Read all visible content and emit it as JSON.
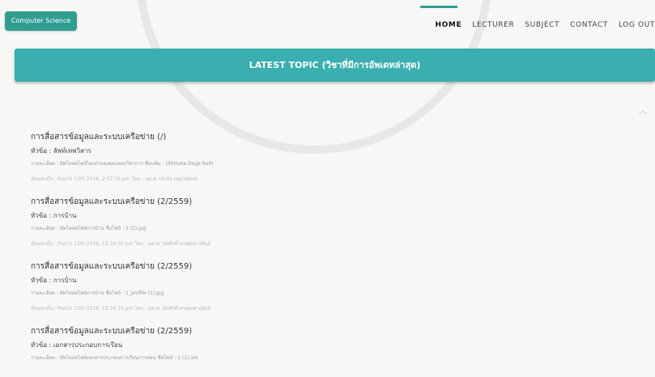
{
  "brand": "Computer Science",
  "nav": {
    "home": "HOME",
    "lecturer": "LECTURER",
    "subject": "SUBJECT",
    "contact": "CONTACT",
    "logout": "LOG OUT"
  },
  "banner": "LATEST TOPIC (วิชาที่มีการอัพเดทล่าสุด)",
  "posts": [
    {
      "title": "การสื่อสารข้อมูลและระบบเครือข่าย (/)",
      "subject": "หัวข้อ : ลัพท์เทพวิสาร",
      "detail": "รายละเอียด : อัพโหลดไฟล์ไอเท่าของคุณเพลงวิชาการ ชื่อแฟ้ม : Ultimate Doge Bath",
      "meta": "อัพเดทเมื่อ : March 13th 2016, 2:52:36 pm โดย : นพ.พ. Unde ยพูลุวพพงษ์"
    },
    {
      "title": "การสื่อสารข้อมูลและระบบเครือข่าย (2/2559)",
      "subject": "หัวข้อ : การบ้าน",
      "detail": "รายละเอียด : อัพโหลดไฟล์การบ้าน ชื่อไฟล์ : 1 (2).jpg",
      "meta": "อัพเดทเมื่อ : March 13th 2016, 12:34:30 pm โดย : นพ.พ. นัทศักดิ์ พรพุฒทางสันต์"
    },
    {
      "title": "การสื่อสารข้อมูลและระบบเครือข่าย (2/2559)",
      "subject": "หัวข้อ : การบ้าน",
      "detail": "รายละเอียด : อัพโหลดไฟล์การบ้าน ชื่อไฟล์ : 1_profile (1).jpg",
      "meta": "อัพเดทเมื่อ : March 13th 2016, 12:34:15 pm โดย : นพ.พ. นัทศักดิ์ พรพุฒทางสันต์"
    },
    {
      "title": "การสื่อสารข้อมูลและระบบเครือข่าย (2/2559)",
      "subject": "หัวข้อ : เอกสารประกอบการเรียน",
      "detail": "รายละเอียด : อัพโหลดไฟล์เอกสารประกอบการเรียนการสอน ชื่อไฟล์ : 1 (1).ion",
      "meta": ""
    }
  ]
}
